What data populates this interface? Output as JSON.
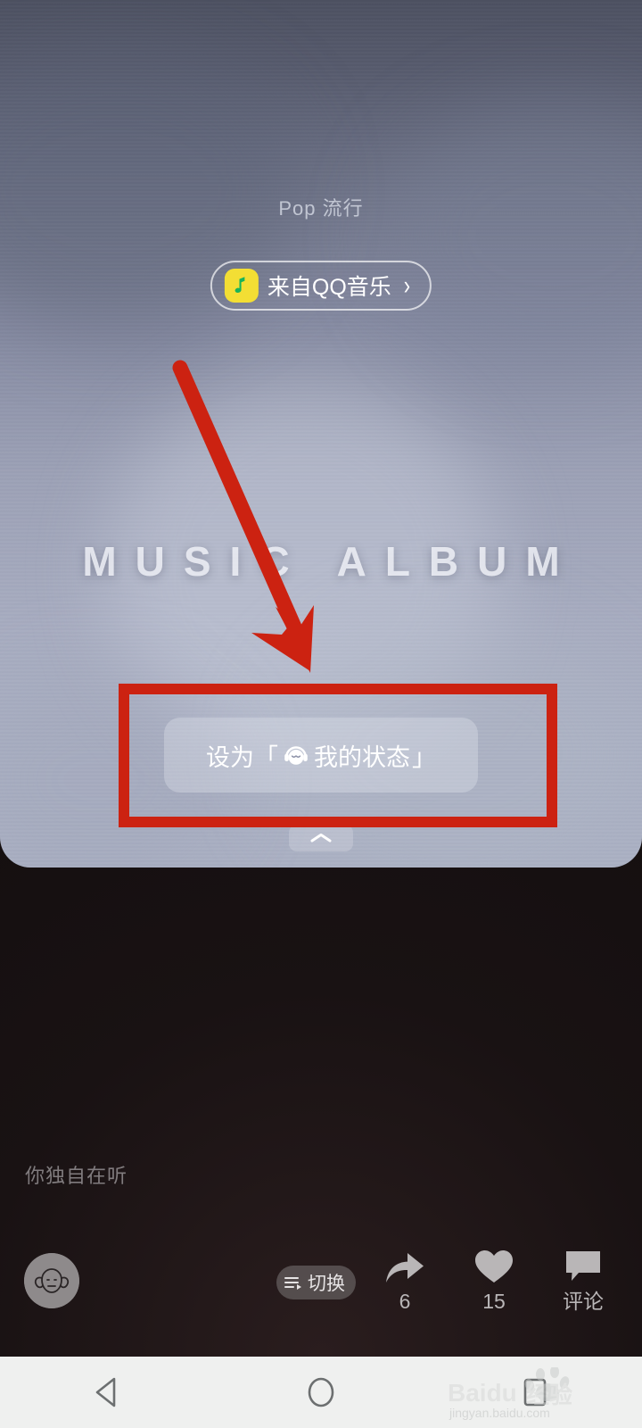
{
  "card": {
    "genre_label": "Pop 流行",
    "source_chip": {
      "icon": "qq-music-note-icon",
      "label": "来自QQ音乐",
      "chevron": "›"
    },
    "album_wordmark": "MUSIC ALBUM",
    "status_button": {
      "prefix": "设为「",
      "emoji": "headphones-face-emoji",
      "text": "我的状态",
      "suffix": "」"
    },
    "handle_icon": "chevron-up-icon"
  },
  "annotation": {
    "highlight_color": "#cc2211",
    "arrow": "down-right-arrow",
    "rect": "highlight-rectangle"
  },
  "player": {
    "listening_note": "你独自在听",
    "avatar": "user-avatar",
    "switch_button": {
      "icon": "playlist-icon",
      "label": "切换"
    },
    "actions": [
      {
        "icon": "share-icon",
        "count": "6",
        "name": "share"
      },
      {
        "icon": "heart-icon",
        "count": "15",
        "name": "like"
      },
      {
        "icon": "comment-icon",
        "count": "评论",
        "name": "comment"
      }
    ]
  },
  "navbar": {
    "back": "back-triangle-icon",
    "home": "home-circle-icon",
    "recents": "recents-square-icon"
  },
  "watermark": {
    "brand": "Baidu",
    "suffix": "经验",
    "url": "jingyan.baidu.com"
  }
}
